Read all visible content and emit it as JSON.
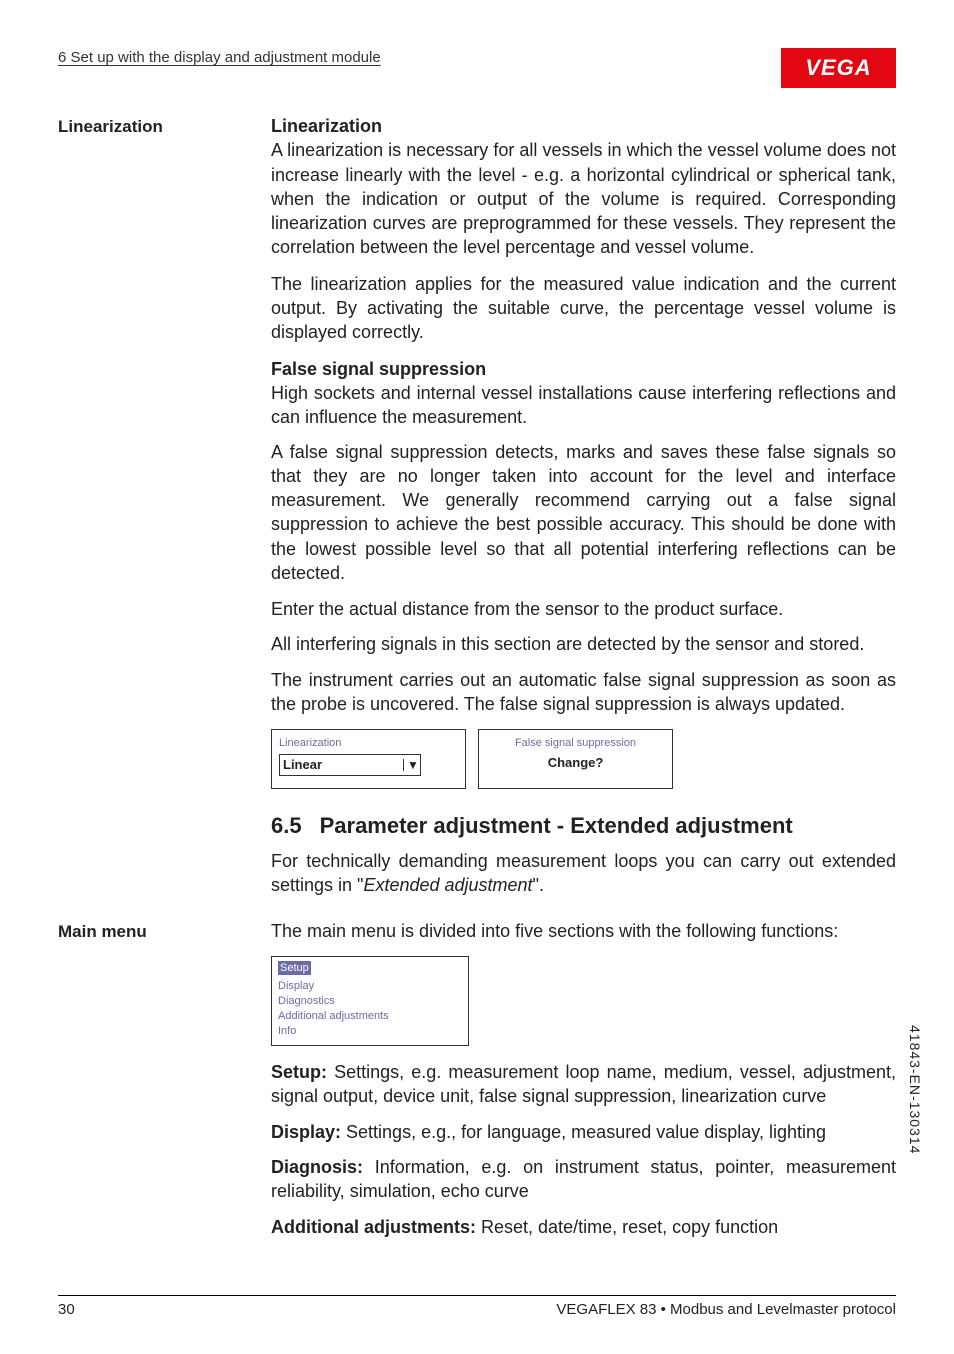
{
  "header": {
    "running_head": "6 Set up with the display and adjustment module",
    "logo_text": "VEGA"
  },
  "sidebar": {
    "linearization": "Linearization",
    "main_menu": "Main menu"
  },
  "s1": {
    "title": "Linearization",
    "p1": "A linearization is necessary for all vessels in which the vessel volume does not increase linearly with the level - e.g. a horizontal cylindrical or spherical tank, when the indication or output of the volume is required. Corresponding linearization curves are preprogrammed for these vessels. They represent the correlation between the level percentage and vessel volume.",
    "p2": "The linearization applies for the measured value indication and the current output. By activating the suitable curve, the percentage vessel volume is displayed correctly."
  },
  "s2": {
    "title": "False signal suppression",
    "p1": "High sockets and internal vessel installations cause interfering reflections and can influence the measurement.",
    "p2": "A false signal suppression detects, marks and saves these false signals so that they are no longer taken into account for the level and interface measurement. We generally recommend carrying out a false signal suppression to achieve the best possible accuracy. This should be done with the lowest possible level so that all potential interfering reflections can be detected.",
    "p3": "Enter the actual distance from the sensor to the product surface.",
    "p4": "All interfering signals in this section are detected by the sensor and stored.",
    "p5": "The instrument carries out an automatic false signal suppression as soon as the probe is uncovered. The false signal suppression is always updated."
  },
  "ui": {
    "box1_title": "Linearization",
    "box1_value": "Linear",
    "box2_title": "False signal suppression",
    "box2_msg": "Change?"
  },
  "h65": {
    "num": "6.5",
    "title": "Parameter adjustment - Extended adjustment",
    "p1a": "For technically demanding measurement loops you can carry out extended settings in \"",
    "p1_it": "Extended adjustment",
    "p1b": "\"."
  },
  "mainmenu": {
    "intro": "The main menu is divided into five sections with the following functions:",
    "items": {
      "i0": "Setup",
      "i1": "Display",
      "i2": "Diagnostics",
      "i3": "Additional adjustments",
      "i4": "Info"
    },
    "setup_lead": "Setup:",
    "setup_body": " Settings, e.g. measurement loop name, medium, vessel, adjustment, signal output, device unit, false signal suppression, linearization curve",
    "display_lead": "Display:",
    "display_body": " Settings, e.g., for language, measured value display, lighting",
    "diag_lead": "Diagnosis:",
    "diag_body": " Information, e.g. on instrument status, pointer, measurement reliability, simulation, echo curve",
    "addl_lead": "Additional adjustments:",
    "addl_body": " Reset, date/time, reset, copy function"
  },
  "footer": {
    "page": "30",
    "doc": "VEGAFLEX 83 • Modbus and Levelmaster protocol"
  },
  "side_code": "41843-EN-130314"
}
